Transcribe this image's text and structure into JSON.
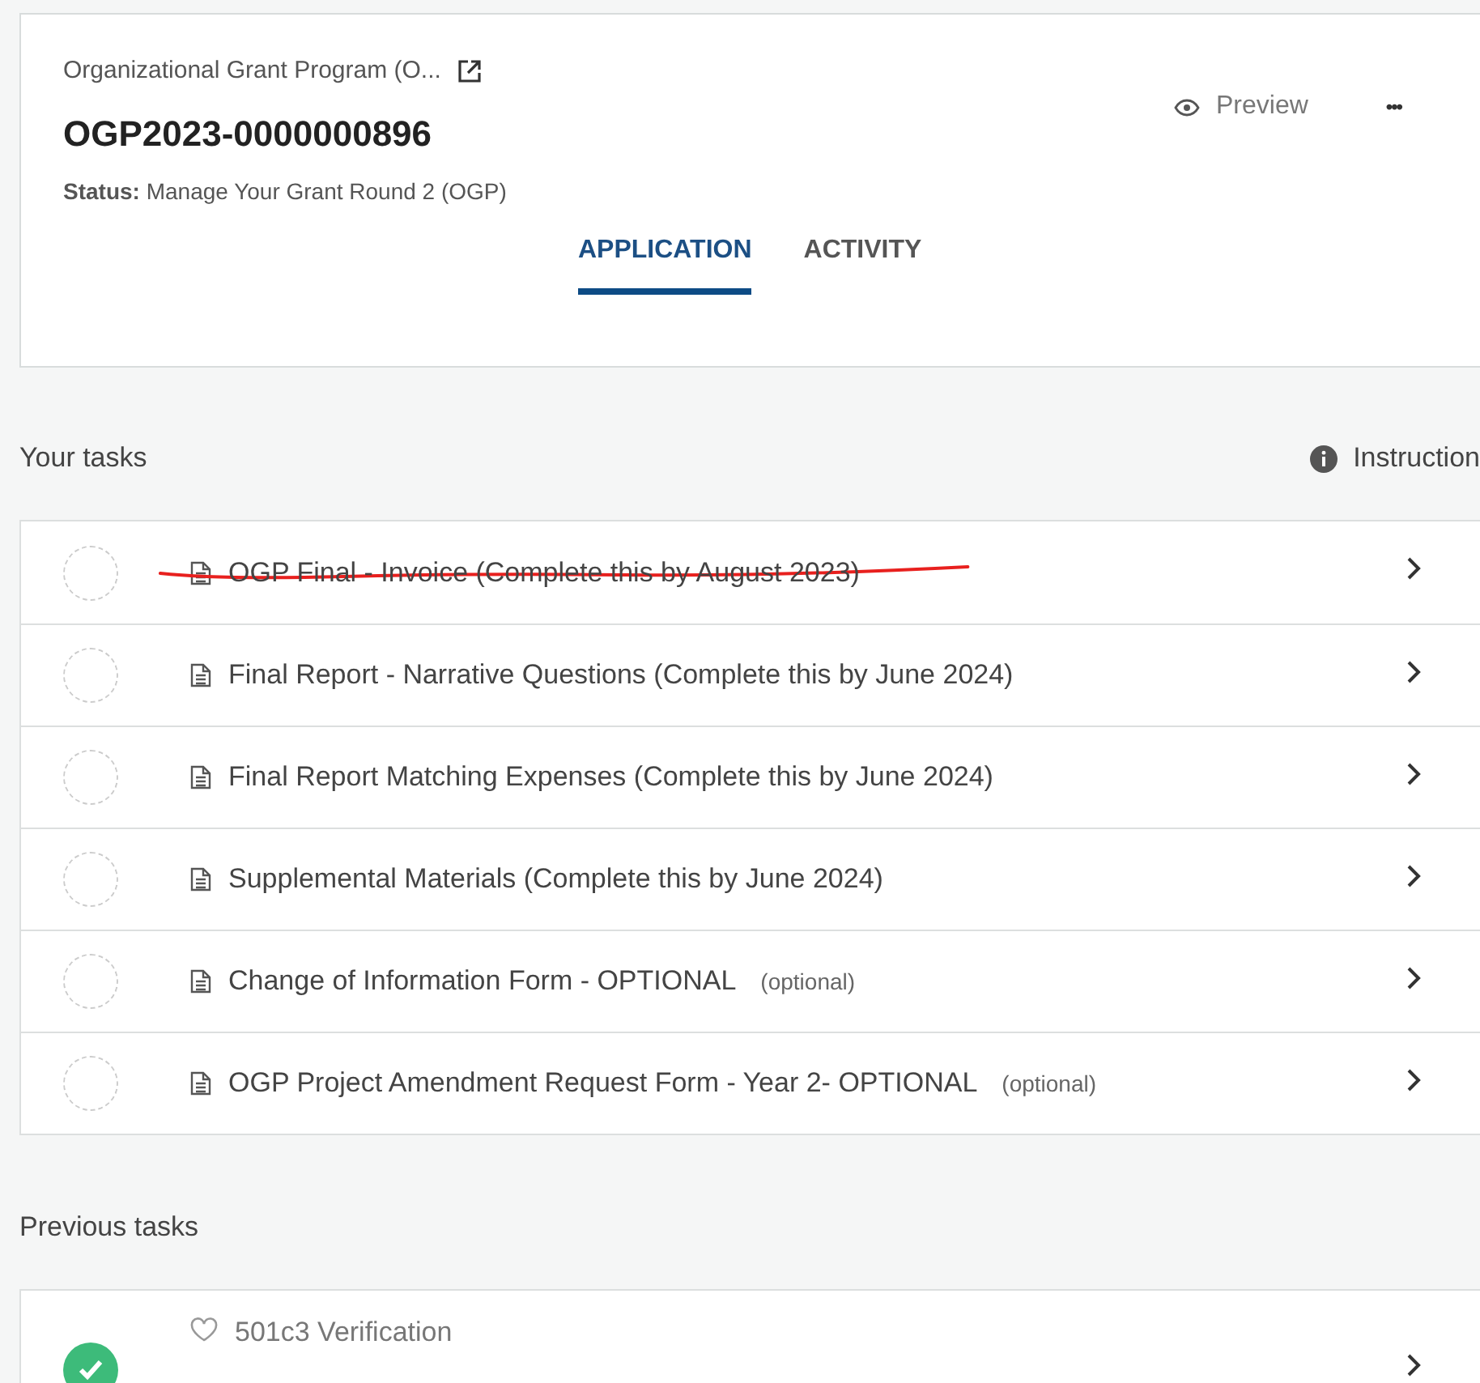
{
  "header": {
    "program": "Organizational Grant Program (O...",
    "id": "OGP2023-0000000896",
    "status_label": "Status:",
    "status": "Manage Your Grant Round 2 (OGP)",
    "preview": "Preview",
    "more": "•••",
    "tabs": [
      {
        "label": "APPLICATION",
        "selected": true
      },
      {
        "label": "ACTIVITY",
        "selected": false
      }
    ]
  },
  "your_tasks": {
    "title": "Your tasks",
    "instructions": "Instruction",
    "tasks": [
      {
        "name": "OGP Final - Invoice (Complete this by August 2023)",
        "struck": true
      },
      {
        "name": "Final Report - Narrative Questions (Complete this by June 2024)",
        "struck": false
      },
      {
        "name": "Final Report Matching Expenses (Complete this by June 2024)",
        "struck": false
      },
      {
        "name": "Supplemental Materials (Complete this by June 2024)",
        "struck": false
      },
      {
        "name": "Change of Information Form - OPTIONAL",
        "note": "(optional)",
        "struck": false
      },
      {
        "name": "OGP Project Amendment Request Form - Year 2- OPTIONAL",
        "note": "(optional)",
        "struck": false
      }
    ]
  },
  "previous_tasks": {
    "title": "Previous tasks",
    "tasks": [
      {
        "name": "501c3 Verification",
        "completed": true
      }
    ]
  }
}
